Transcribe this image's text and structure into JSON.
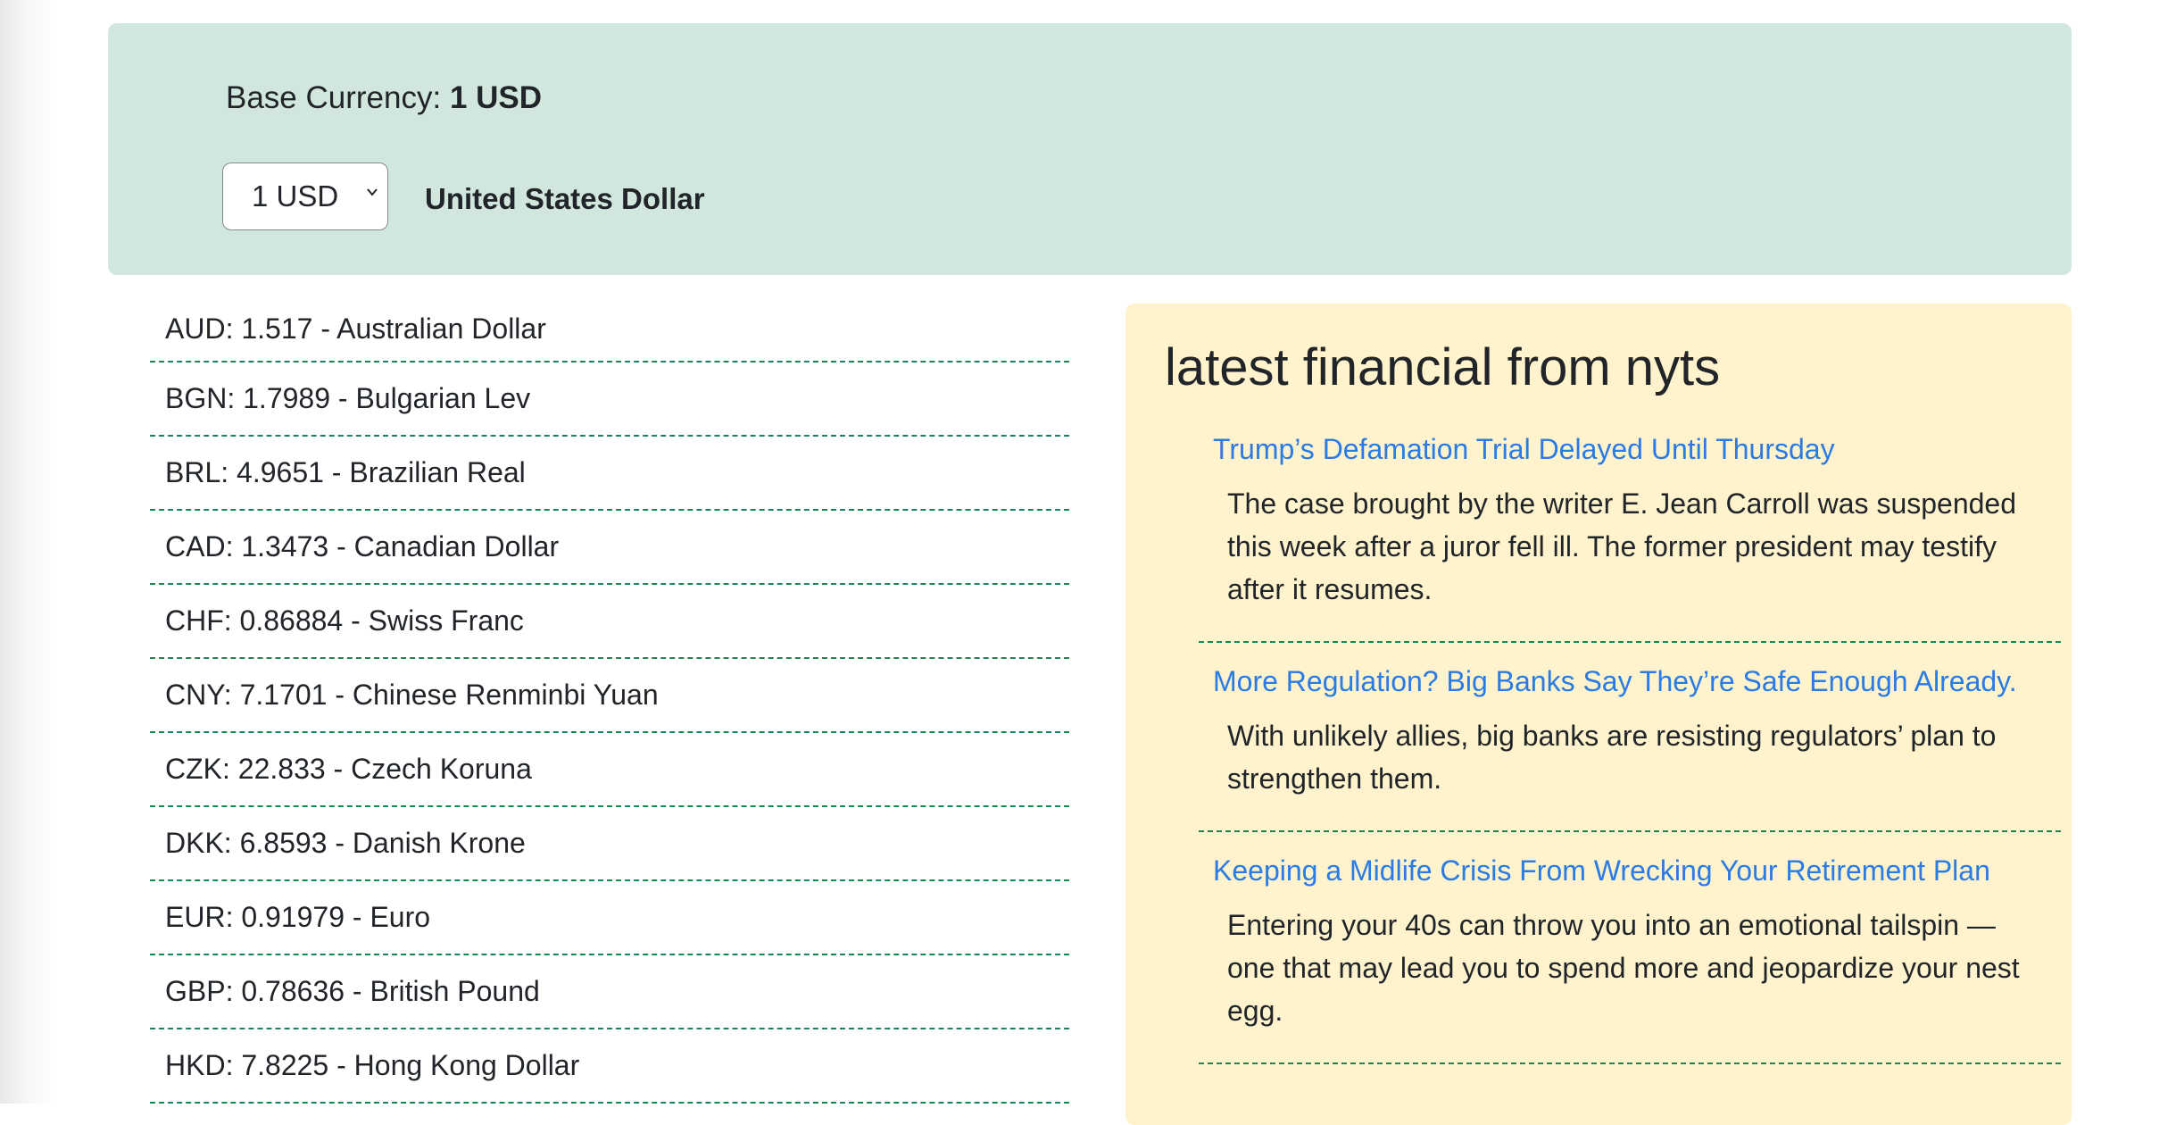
{
  "header": {
    "base_label": "Base Currency:",
    "base_value": "1 USD",
    "select_value": "1 USD",
    "currency_name": "United States Dollar"
  },
  "rates": [
    {
      "text": "AUD: 1.517 - Australian Dollar"
    },
    {
      "text": "BGN: 1.7989 - Bulgarian Lev"
    },
    {
      "text": "BRL: 4.9651 - Brazilian Real"
    },
    {
      "text": "CAD: 1.3473 - Canadian Dollar"
    },
    {
      "text": "CHF: 0.86884 - Swiss Franc"
    },
    {
      "text": "CNY: 7.1701 - Chinese Renminbi Yuan"
    },
    {
      "text": "CZK: 22.833 - Czech Koruna"
    },
    {
      "text": "DKK: 6.8593 - Danish Krone"
    },
    {
      "text": "EUR: 0.91979 - Euro"
    },
    {
      "text": "GBP: 0.78636 - British Pound"
    },
    {
      "text": "HKD: 7.8225 - Hong Kong Dollar"
    }
  ],
  "news": {
    "title": "latest financial from nyts",
    "articles": [
      {
        "headline": "Trump’s Defamation Trial Delayed Until Thursday",
        "summary": "The case brought by the writer E. Jean Carroll was suspended this week after a juror fell ill. The former president may testify after it resumes."
      },
      {
        "headline": "More Regulation? Big Banks Say They’re Safe Enough Already.",
        "summary": "With unlikely allies, big banks are resisting regulators’ plan to strengthen them."
      },
      {
        "headline": "Keeping a Midlife Crisis From Wrecking Your Retirement Plan",
        "summary": "Entering your 40s can throw you into an emotional tailspin — one that may lead you to spend more and jeopardize your nest egg."
      }
    ]
  },
  "colors": {
    "header_bg": "#d1e7dd",
    "news_bg": "#fff3cd",
    "divider": "#198754",
    "link": "#2a7be4"
  }
}
